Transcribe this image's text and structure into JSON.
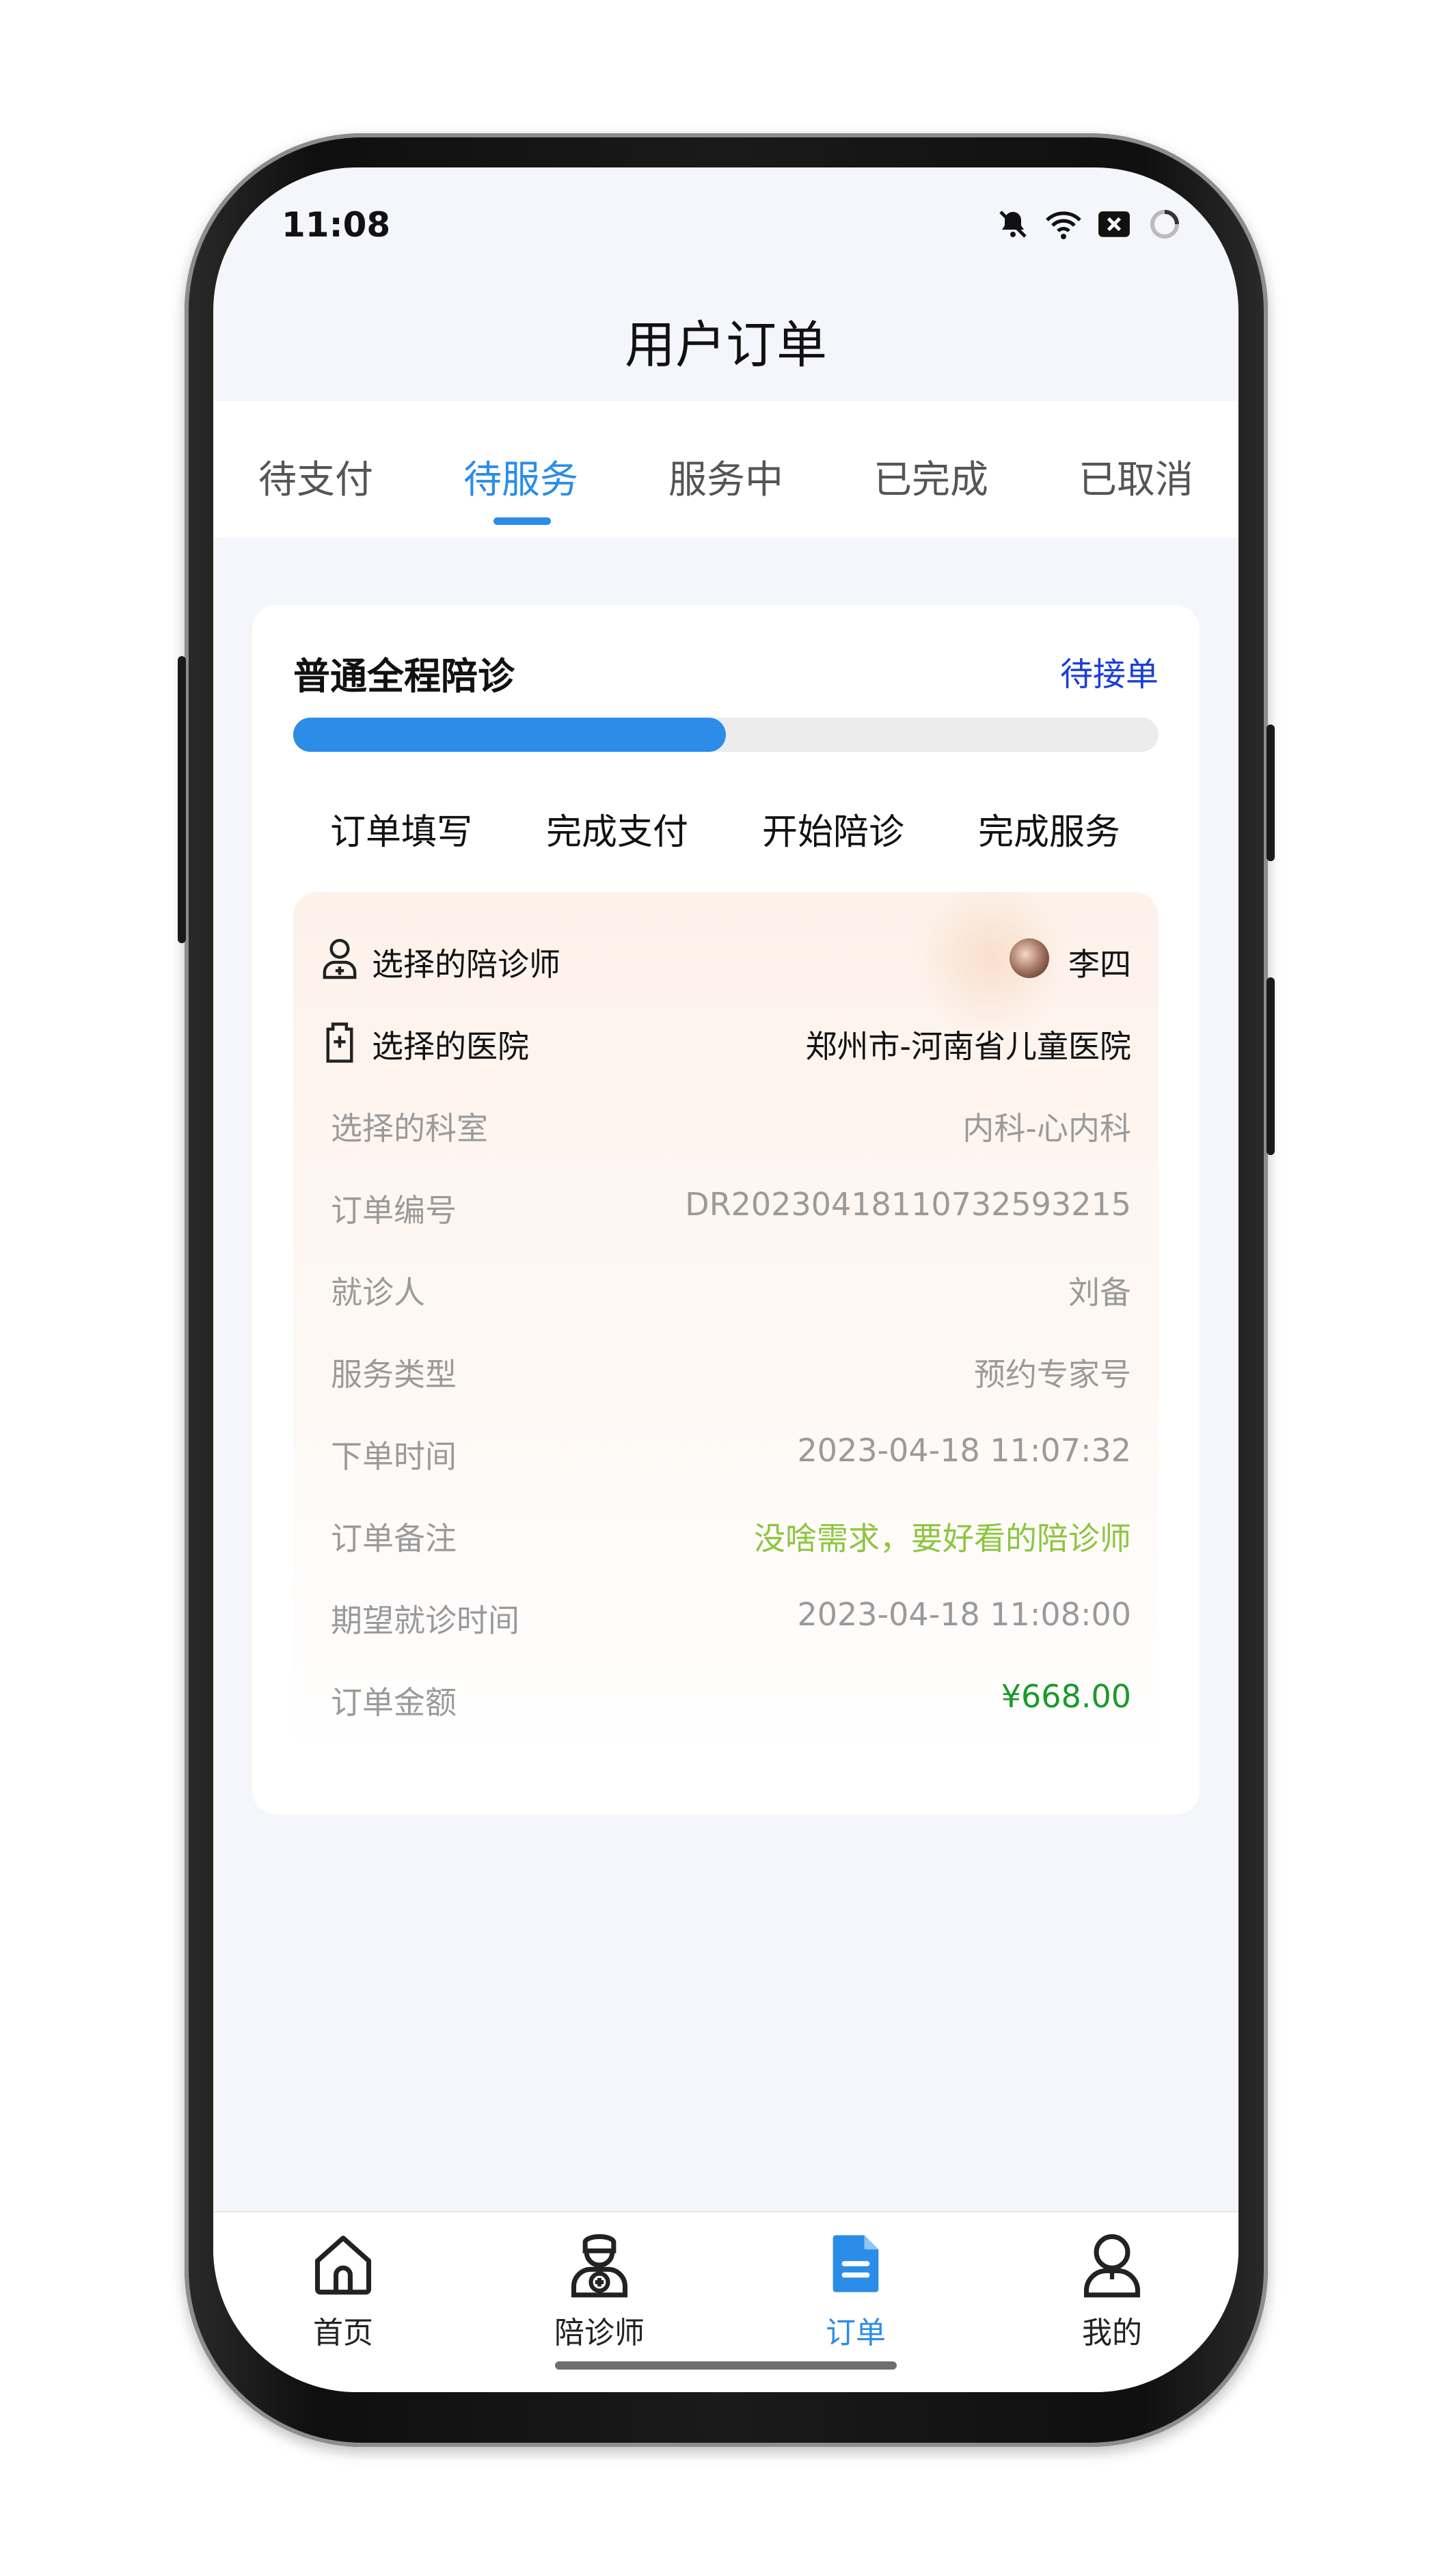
{
  "status_bar": {
    "time": "11:08"
  },
  "header": {
    "title": "用户订单"
  },
  "tabs": [
    {
      "label": "待支付"
    },
    {
      "label": "待服务"
    },
    {
      "label": "服务中"
    },
    {
      "label": "已完成"
    },
    {
      "label": "已取消"
    }
  ],
  "order": {
    "title": "普通全程陪诊",
    "status": "待接单",
    "progress": 0.5,
    "steps": [
      "订单填写",
      "完成支付",
      "开始陪诊",
      "完成服务"
    ],
    "escort": {
      "label": "选择的陪诊师",
      "value": "李四"
    },
    "hospital": {
      "label": "选择的医院",
      "value": "郑州市-河南省儿童医院"
    },
    "details": [
      {
        "label": "选择的科室",
        "value": "内科-心内科"
      },
      {
        "label": "订单编号",
        "value": "DR20230418110732593215"
      },
      {
        "label": "就诊人",
        "value": "刘备"
      },
      {
        "label": "服务类型",
        "value": "预约专家号"
      },
      {
        "label": "下单时间",
        "value": "2023-04-18 11:07:32"
      },
      {
        "label": "订单备注",
        "value": "没啥需求，要好看的陪诊师"
      },
      {
        "label": "期望就诊时间",
        "value": "2023-04-18 11:08:00"
      },
      {
        "label": "订单金额",
        "value": "¥668.00"
      }
    ]
  },
  "bottom_nav": [
    {
      "label": "首页",
      "icon": "home-icon"
    },
    {
      "label": "陪诊师",
      "icon": "doctor-icon"
    },
    {
      "label": "订单",
      "icon": "order-icon"
    },
    {
      "label": "我的",
      "icon": "user-icon"
    }
  ],
  "colors": {
    "accent": "#2b8de8",
    "status": "#1a3ed8",
    "note": "#8cc63f",
    "amount": "#1a9a2a"
  }
}
